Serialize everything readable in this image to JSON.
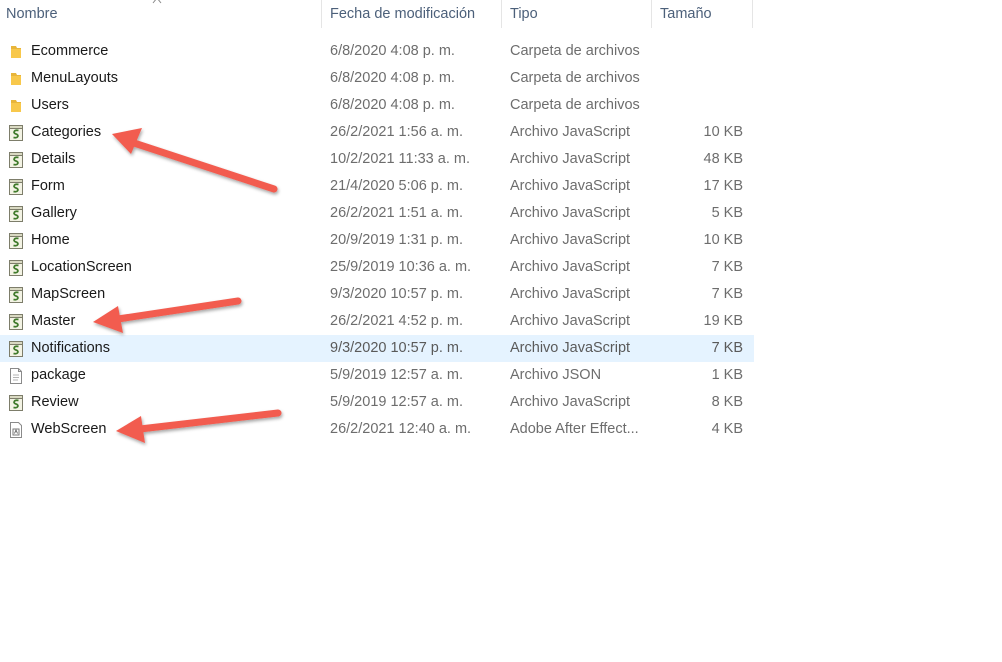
{
  "columns": {
    "name": "Nombre",
    "date": "Fecha de modificación",
    "type": "Tipo",
    "size": "Tamaño"
  },
  "files": [
    {
      "name": "Ecommerce",
      "date": "6/8/2020 4:08 p. m.",
      "type": "Carpeta de archivos",
      "size": "",
      "icon": "folder-icon"
    },
    {
      "name": "MenuLayouts",
      "date": "6/8/2020 4:08 p. m.",
      "type": "Carpeta de archivos",
      "size": "",
      "icon": "folder-icon"
    },
    {
      "name": "Users",
      "date": "6/8/2020 4:08 p. m.",
      "type": "Carpeta de archivos",
      "size": "",
      "icon": "folder-icon"
    },
    {
      "name": "Categories",
      "date": "26/2/2021 1:56 a. m.",
      "type": "Archivo JavaScript",
      "size": "10 KB",
      "icon": "javascript-file-icon"
    },
    {
      "name": "Details",
      "date": "10/2/2021 11:33 a. m.",
      "type": "Archivo JavaScript",
      "size": "48 KB",
      "icon": "javascript-file-icon"
    },
    {
      "name": "Form",
      "date": "21/4/2020 5:06 p. m.",
      "type": "Archivo JavaScript",
      "size": "17 KB",
      "icon": "javascript-file-icon"
    },
    {
      "name": "Gallery",
      "date": "26/2/2021 1:51 a. m.",
      "type": "Archivo JavaScript",
      "size": "5 KB",
      "icon": "javascript-file-icon"
    },
    {
      "name": "Home",
      "date": "20/9/2019 1:31 p. m.",
      "type": "Archivo JavaScript",
      "size": "10 KB",
      "icon": "javascript-file-icon"
    },
    {
      "name": "LocationScreen",
      "date": "25/9/2019 10:36 a. m.",
      "type": "Archivo JavaScript",
      "size": "7 KB",
      "icon": "javascript-file-icon"
    },
    {
      "name": "MapScreen",
      "date": "9/3/2020 10:57 p. m.",
      "type": "Archivo JavaScript",
      "size": "7 KB",
      "icon": "javascript-file-icon"
    },
    {
      "name": "Master",
      "date": "26/2/2021 4:52 p. m.",
      "type": "Archivo JavaScript",
      "size": "19 KB",
      "icon": "javascript-file-icon"
    },
    {
      "name": "Notifications",
      "date": "9/3/2020 10:57 p. m.",
      "type": "Archivo JavaScript",
      "size": "7 KB",
      "icon": "javascript-file-icon",
      "selected": true
    },
    {
      "name": "package",
      "date": "5/9/2019 12:57 a. m.",
      "type": "Archivo JSON",
      "size": "1 KB",
      "icon": "json-file-icon"
    },
    {
      "name": "Review",
      "date": "5/9/2019 12:57 a. m.",
      "type": "Archivo JavaScript",
      "size": "8 KB",
      "icon": "javascript-file-icon"
    },
    {
      "name": "WebScreen",
      "date": "26/2/2021 12:40 a. m.",
      "type": "Adobe After Effect...",
      "size": "4 KB",
      "icon": "after-effects-file-icon"
    }
  ],
  "colors": {
    "header_text": "#4c607a",
    "selected_row": "#e5f3ff",
    "arrow": "#f25c4f",
    "folder": "#f8c84b"
  },
  "annotations": {
    "arrow_targets": [
      "Categories",
      "Master",
      "WebScreen"
    ]
  }
}
